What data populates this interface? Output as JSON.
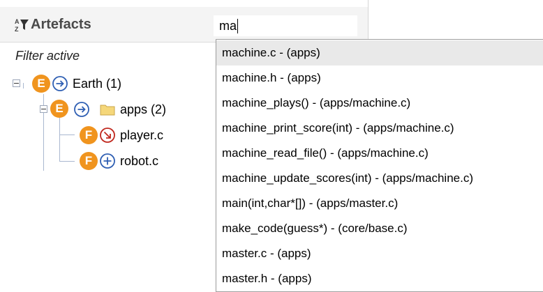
{
  "panel": {
    "title": "Artefacts",
    "filter_status": "Filter active"
  },
  "tree": {
    "earth": {
      "badge": "E",
      "label": "Earth (1)",
      "icon": "arrow-right-circle-icon"
    },
    "apps": {
      "badge": "E",
      "label": "apps (2)",
      "icon": "arrow-right-circle-icon",
      "folder": "folder-icon"
    },
    "player": {
      "badge": "F",
      "label": "player.c",
      "icon": "arrow-down-right-circle-icon"
    },
    "robot": {
      "badge": "F",
      "label": "robot.c",
      "icon": "plus-circle-icon"
    }
  },
  "search": {
    "value": "ma"
  },
  "dropdown": {
    "items": [
      "machine.c - (apps)",
      "machine.h - (apps)",
      "machine_plays() - (apps/machine.c)",
      "machine_print_score(int) - (apps/machine.c)",
      "machine_read_file() - (apps/machine.c)",
      "machine_update_scores(int) - (apps/machine.c)",
      "main(int,char*[]) - (apps/master.c)",
      "make_code(guess*) - (core/base.c)",
      "master.c - (apps)",
      "master.h - (apps)"
    ],
    "selected_index": 0
  },
  "colors": {
    "badge": "#f0941e",
    "icon_blue": "#2f5fb3",
    "icon_red": "#c0281e",
    "folder": "#f5d77a",
    "highlight": "#e9e9e9"
  }
}
